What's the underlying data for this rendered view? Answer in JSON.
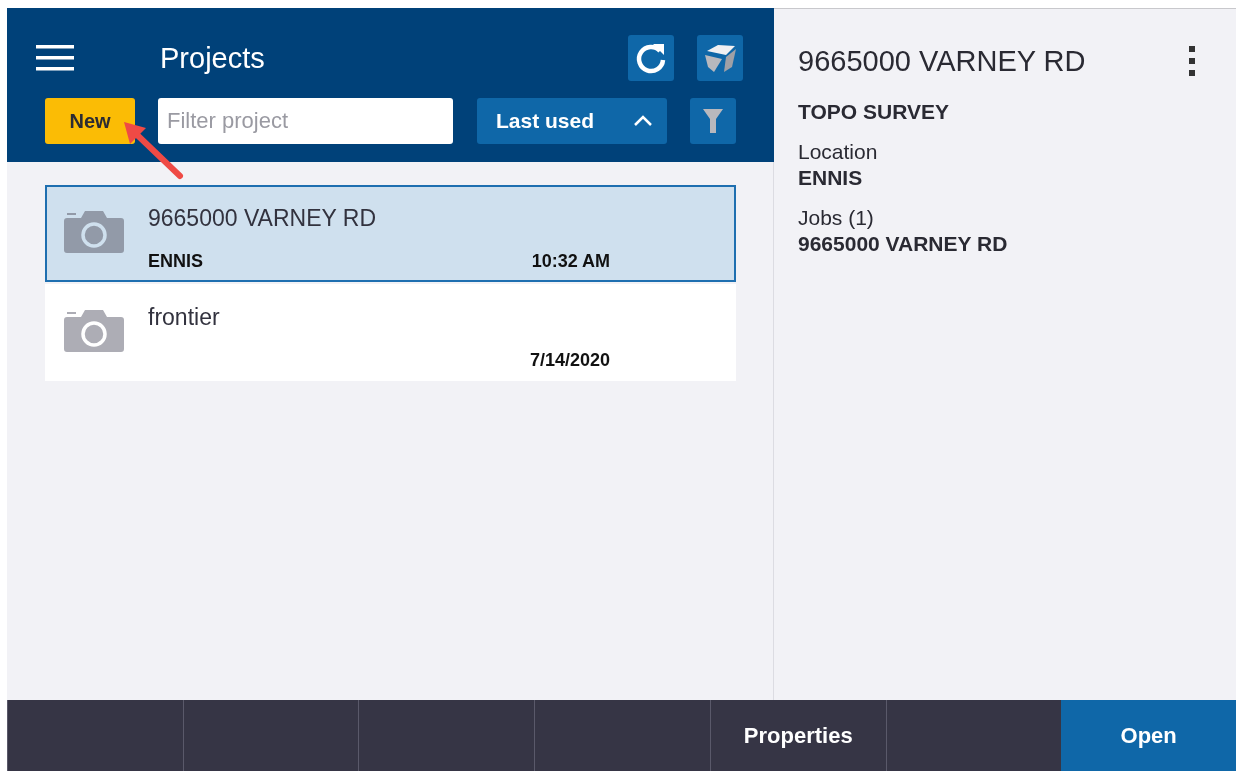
{
  "header": {
    "title": "Projects",
    "new_button": "New",
    "filter": {
      "placeholder": "Filter project"
    },
    "sort": {
      "label": "Last used",
      "expanded": true
    }
  },
  "projects": [
    {
      "name": "9665000 VARNEY RD",
      "location": "ENNIS",
      "time": "10:32 AM",
      "selected": true
    },
    {
      "name": "frontier",
      "time": "7/14/2020",
      "selected": false
    }
  ],
  "details": {
    "title": "9665000 VARNEY RD",
    "subtitle": "TOPO SURVEY",
    "fields": [
      {
        "label": "Location",
        "value": "ENNIS"
      },
      {
        "label": "Jobs (1)",
        "value": "9665000 VARNEY RD"
      }
    ]
  },
  "footer": [
    {
      "kind": "blank"
    },
    {
      "kind": "blank"
    },
    {
      "kind": "blank"
    },
    {
      "kind": "blank"
    },
    {
      "kind": "plain",
      "label": "Properties"
    },
    {
      "kind": "blank"
    },
    {
      "kind": "primary",
      "label": "Open"
    }
  ]
}
